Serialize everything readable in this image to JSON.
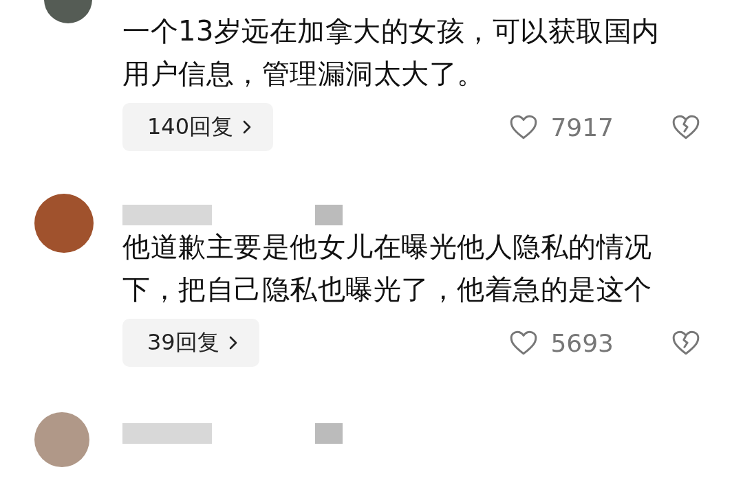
{
  "comments": [
    {
      "kind": "top_cut",
      "text": "一个13岁远在加拿大的女孩，可以获取国内用户信息，管理漏洞太大了。",
      "replies": "140回复",
      "likes": "7917"
    },
    {
      "kind": "full",
      "text": "他道歉主要是他女儿在曝光他人隐私的情况下，把自己隐私也曝光了，他着急的是这个",
      "replies": "39回复",
      "likes": "5693"
    },
    {
      "kind": "bottom_cut"
    }
  ]
}
